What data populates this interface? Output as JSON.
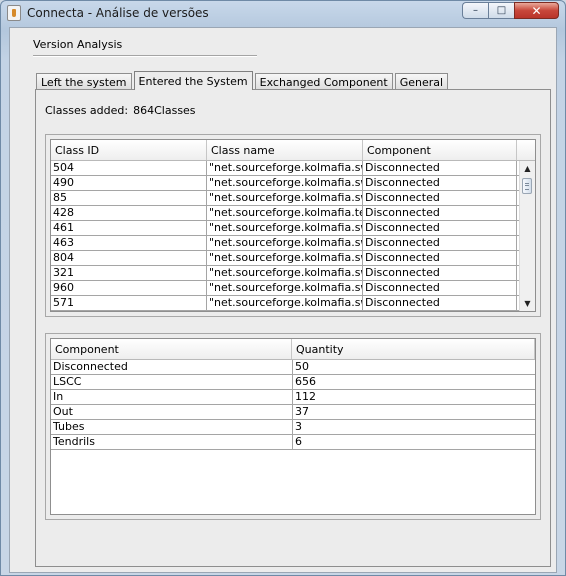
{
  "window": {
    "title": "Connecta - Análise de versões",
    "minimize_glyph": "–",
    "maximize_glyph": "□",
    "close_glyph": "✕"
  },
  "section": {
    "label": "Version Analysis"
  },
  "tabs": [
    {
      "label": "Left the system",
      "active": false
    },
    {
      "label": "Entered the System",
      "active": true
    },
    {
      "label": "Exchanged Component",
      "active": false
    },
    {
      "label": "General",
      "active": false
    }
  ],
  "summary": {
    "label": "Classes added:",
    "value": "864Classes"
  },
  "classes_table": {
    "columns": [
      "Class ID",
      "Class name",
      "Component"
    ],
    "rows": [
      [
        "504",
        "\"net.sourceforge.kolmafia.swi...",
        "Disconnected"
      ],
      [
        "490",
        "\"net.sourceforge.kolmafia.swi...",
        "Disconnected"
      ],
      [
        "85",
        "\"net.sourceforge.kolmafia.swi...",
        "Disconnected"
      ],
      [
        "428",
        "\"net.sourceforge.kolmafia.text...",
        "Disconnected"
      ],
      [
        "461",
        "\"net.sourceforge.kolmafia.swi...",
        "Disconnected"
      ],
      [
        "463",
        "\"net.sourceforge.kolmafia.swi...",
        "Disconnected"
      ],
      [
        "804",
        "\"net.sourceforge.kolmafia.swi...",
        "Disconnected"
      ],
      [
        "321",
        "\"net.sourceforge.kolmafia.swi...",
        "Disconnected"
      ],
      [
        "960",
        "\"net.sourceforge.kolmafia.swi...",
        "Disconnected"
      ],
      [
        "571",
        "\"net.sourceforge.kolmafia.swi...",
        "Disconnected"
      ]
    ],
    "scroll_up_glyph": "▲",
    "scroll_down_glyph": "▼"
  },
  "component_table": {
    "columns": [
      "Component",
      "Quantity"
    ],
    "rows": [
      [
        "Disconnected",
        "50"
      ],
      [
        "LSCC",
        "656"
      ],
      [
        "In",
        "112"
      ],
      [
        "Out",
        "37"
      ],
      [
        "Tubes",
        "3"
      ],
      [
        "Tendrils",
        "6"
      ]
    ]
  }
}
